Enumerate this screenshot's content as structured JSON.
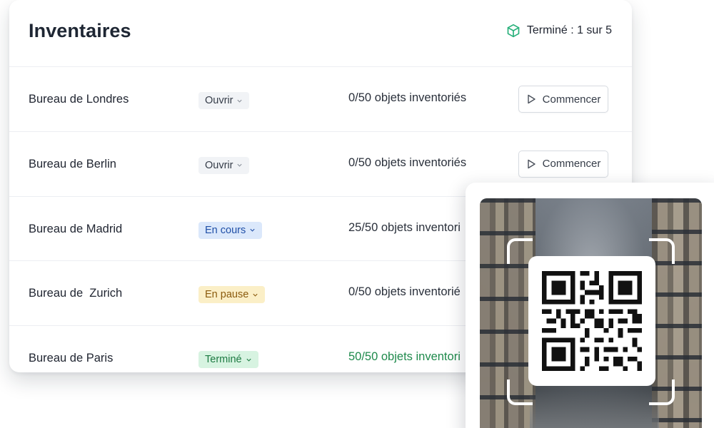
{
  "header": {
    "title": "Inventaires",
    "status_icon": "box-icon",
    "status_text": "Terminé : 1 sur 5",
    "accent_color": "#27b07a"
  },
  "rows": [
    {
      "name": "Bureau de Londres",
      "status": "Ouvrir",
      "count": "0/50 objets inventoriés",
      "action": "Commencer"
    },
    {
      "name": "Bureau de Berlin",
      "status": "Ouvrir",
      "count": "0/50 objets inventoriés",
      "action": "Commencer"
    },
    {
      "name": "Bureau de Madrid",
      "status": "En cours",
      "count": "25/50 objets inventori"
    },
    {
      "name": "Bureau de  Zurich",
      "status": "En pause",
      "count": "0/50 objets inventorié"
    },
    {
      "name": "Bureau de Paris",
      "status": "Terminé",
      "count": "50/50 objets inventori"
    }
  ],
  "scanner": {
    "image": "warehouse-aisle",
    "qr_icon": "qr-code-icon"
  }
}
